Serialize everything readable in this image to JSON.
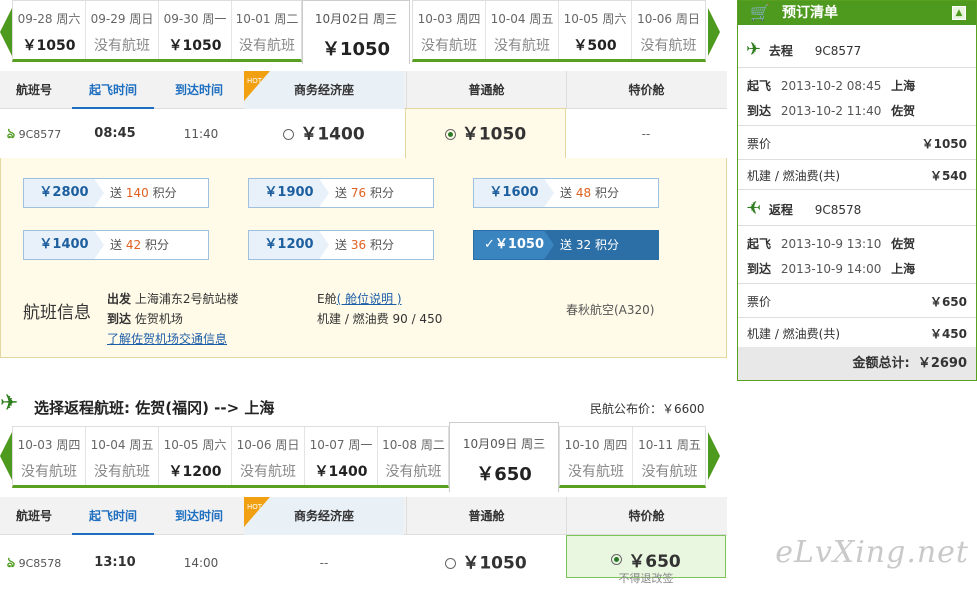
{
  "outbound_dates": {
    "cells": [
      {
        "date": "09-28 周六",
        "price": "￥1050"
      },
      {
        "date": "09-29 周日",
        "price": "没有航班"
      },
      {
        "date": "09-30 周一",
        "price": "￥1050"
      },
      {
        "date": "10-01 周二",
        "price": "没有航班"
      },
      {
        "date": "10月02日 周三",
        "price": "￥1050"
      },
      {
        "date": "10-03 周四",
        "price": "没有航班"
      },
      {
        "date": "10-04 周五",
        "price": "没有航班"
      },
      {
        "date": "10-05 周六",
        "price": "￥500"
      },
      {
        "date": "10-06 周日",
        "price": "没有航班"
      }
    ]
  },
  "table_headers": {
    "flight_no": "航班号",
    "depart": "起飞时间",
    "arrive": "到达时间",
    "hot": "HOT",
    "business": "商务经济座",
    "economy": "普通舱",
    "special": "特价舱"
  },
  "outbound_flight": {
    "flight_no": "9C8577",
    "depart": "08:45",
    "arrive": "11:40",
    "business_price": "￥1400",
    "economy_price": "￥1050",
    "special": "--"
  },
  "fare_options": [
    {
      "price": "￥2800",
      "prefix": "送",
      "points": "140",
      "suffix": "积分"
    },
    {
      "price": "￥1900",
      "prefix": "送",
      "points": "76",
      "suffix": "积分"
    },
    {
      "price": "￥1600",
      "prefix": "送",
      "points": "48",
      "suffix": "积分"
    },
    {
      "price": "￥1400",
      "prefix": "送",
      "points": "42",
      "suffix": "积分"
    },
    {
      "price": "￥1200",
      "prefix": "送",
      "points": "36",
      "suffix": "积分"
    },
    {
      "price": "✓￥1050",
      "prefix": "送",
      "points": "32",
      "suffix": "积分"
    }
  ],
  "flight_info": {
    "title": "航班信息",
    "depart_label": "出发",
    "depart_value": "上海浦东2号航站楼",
    "arrive_label": "到达",
    "arrive_value": "佐贺机场",
    "traffic_link": "了解佐贺机场交通信息",
    "cabin": "E舱",
    "cabin_link": "( 舱位说明 )",
    "tax": "机建 / 燃油费 90 / 450",
    "airline": "春秋航空(A320)"
  },
  "return_section": {
    "title": "选择返程航班: 佐贺(福冈) --> 上海",
    "public_price_label": "民航公布价：",
    "public_price": "￥6600",
    "cells": [
      {
        "date": "10-03 周四",
        "price": "没有航班"
      },
      {
        "date": "10-04 周五",
        "price": "没有航班"
      },
      {
        "date": "10-05 周六",
        "price": "￥1200"
      },
      {
        "date": "10-06 周日",
        "price": "没有航班"
      },
      {
        "date": "10-07 周一",
        "price": "￥1400"
      },
      {
        "date": "10-08 周二",
        "price": "没有航班"
      },
      {
        "date": "10月09日 周三",
        "price": "￥650"
      },
      {
        "date": "10-10 周四",
        "price": "没有航班"
      },
      {
        "date": "10-11 周五",
        "price": "没有航班"
      }
    ]
  },
  "return_flight": {
    "flight_no": "9C8578",
    "depart": "13:10",
    "arrive": "14:00",
    "business": "--",
    "economy_price": "￥1050",
    "special_price": "￥650",
    "special_note": "不得退改签"
  },
  "order": {
    "title": "预订清单",
    "out_label": "去程",
    "out_flight": "9C8577",
    "out_depart_label": "起飞",
    "out_depart": "2013-10-2 08:45",
    "out_depart_city": "上海",
    "out_arrive_label": "到达",
    "out_arrive": "2013-10-2 11:40",
    "out_arrive_city": "佐贺",
    "out_fare_label": "票价",
    "out_fare": "￥1050",
    "out_tax_label": "机建 / 燃油费(共)",
    "out_tax": "￥540",
    "ret_label": "返程",
    "ret_flight": "9C8578",
    "ret_depart_label": "起飞",
    "ret_depart": "2013-10-9 13:10",
    "ret_depart_city": "佐贺",
    "ret_arrive_label": "到达",
    "ret_arrive": "2013-10-9 14:00",
    "ret_arrive_city": "上海",
    "ret_fare_label": "票价",
    "ret_fare": "￥650",
    "ret_tax_label": "机建 / 燃油费(共)",
    "ret_tax": "￥450",
    "total_label": "金额总计:",
    "total": "￥2690"
  },
  "watermark": "eLvXing.net",
  "colors": {
    "green": "#4e9a1e",
    "blue": "#1e6fc0",
    "orange": "#e06020"
  }
}
